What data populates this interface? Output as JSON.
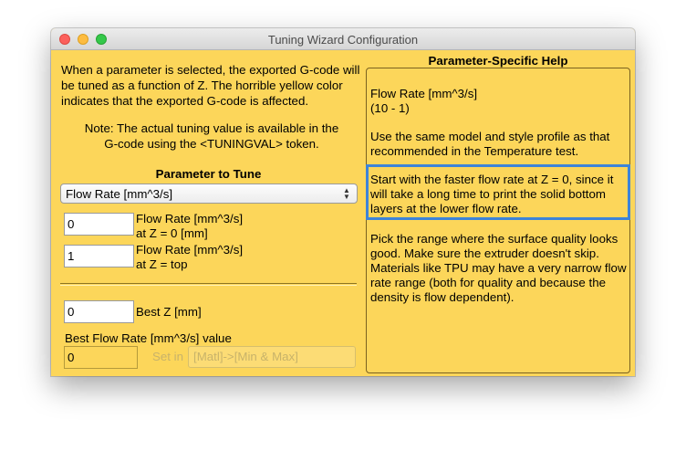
{
  "window": {
    "title": "Tuning Wizard Configuration"
  },
  "intro": {
    "text": "When a parameter is selected, the exported G-code will be tuned as a function of Z.  The horrible yellow color indicates that the exported G-code is affected.",
    "note_line1": "Note: The actual tuning value is available in the",
    "note_line2": "G-code using the <TUNINGVAL> token."
  },
  "parameter": {
    "section_label": "Parameter to Tune",
    "selected": "Flow Rate [mm^3/s]"
  },
  "fields": {
    "z0_value": "0",
    "z0_label_line1": "Flow Rate [mm^3/s]",
    "z0_label_line2": "at Z = 0 [mm]",
    "ztop_value": "1",
    "ztop_label_line1": "Flow Rate [mm^3/s]",
    "ztop_label_line2": "at Z = top",
    "best_z_value": "0",
    "best_z_label": "Best Z [mm]",
    "best_value_label": "Best Flow Rate [mm^3/s] value",
    "best_value": "0",
    "set_in_label": "Set in",
    "set_in_target": "[Matl]->[Min & Max]"
  },
  "help": {
    "title": "Parameter-Specific Help",
    "line1": "Flow Rate [mm^3/s]",
    "line2": "(10 - 1)",
    "para1": "Use the same model and style profile as that recommended in the Temperature test.",
    "para2": "Start with the faster flow rate at Z = 0, since it will take a long time to print the solid bottom layers at the lower flow rate.",
    "para3": "Pick the range where the surface quality looks good. Make sure the extruder doesn't skip. Materials like TPU may have a very narrow flow rate range (both for quality and because the density is flow dependent)."
  },
  "colors": {
    "window_background": "#fcd65a",
    "highlight_border": "#3d84d8"
  },
  "icons": [
    "close-button",
    "minimize-button",
    "zoom-button",
    "select-arrows-icon"
  ]
}
